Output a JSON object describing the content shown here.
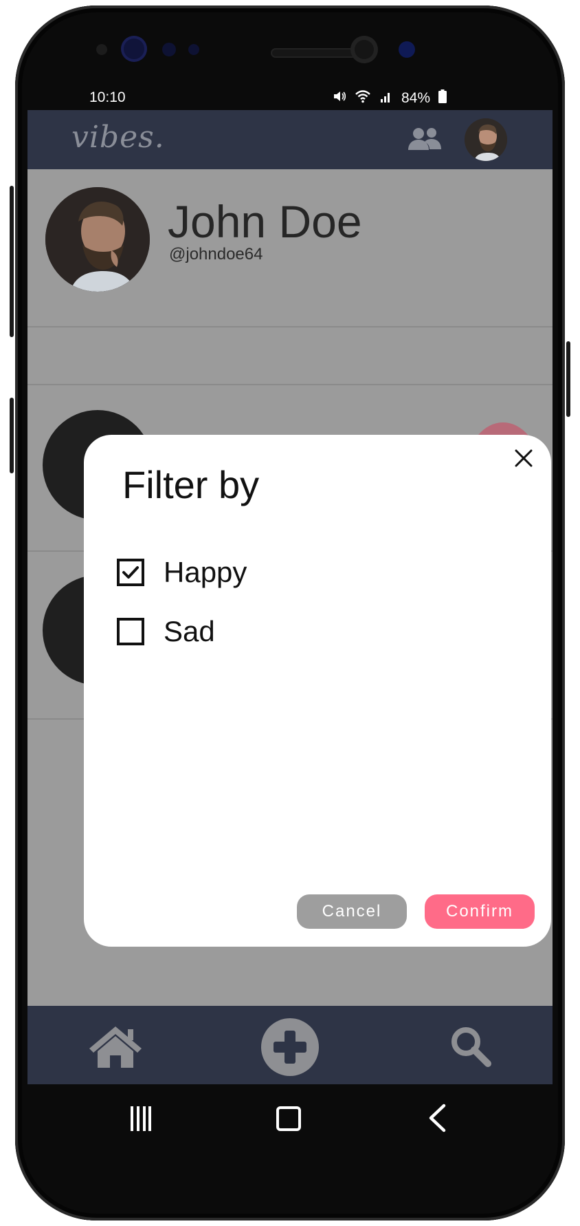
{
  "status": {
    "time": "10:10",
    "battery": "84%"
  },
  "app": {
    "logo": "vibes."
  },
  "profile": {
    "name": "John Doe",
    "handle": "@johndoe64"
  },
  "filter_dialog": {
    "title": "Filter by",
    "options": [
      {
        "label": "Happy",
        "checked": true
      },
      {
        "label": "Sad",
        "checked": false
      }
    ],
    "cancel_label": "Cancel",
    "confirm_label": "Confirm"
  },
  "nav": {
    "items": [
      "home-icon",
      "add-icon",
      "search-icon"
    ]
  },
  "colors": {
    "bar": "#2e3446",
    "overlay": "#9b9b9b",
    "confirm": "#ff6b88",
    "cancel": "#9e9e9e"
  }
}
